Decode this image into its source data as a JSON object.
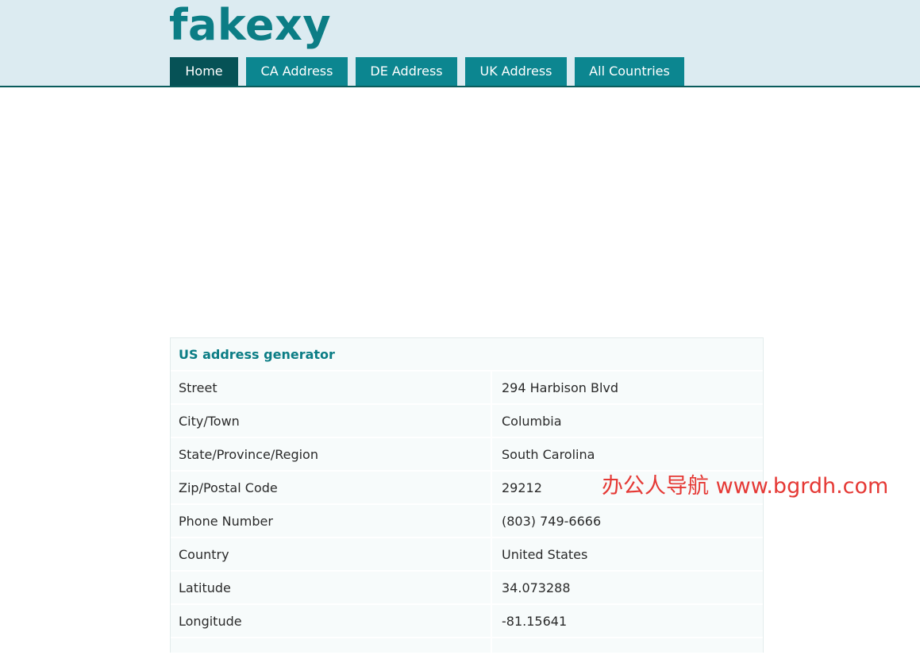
{
  "site": {
    "logo": "fakexy"
  },
  "nav": {
    "tabs": [
      {
        "label": "Home",
        "active": true
      },
      {
        "label": "CA Address",
        "active": false
      },
      {
        "label": "DE Address",
        "active": false
      },
      {
        "label": "UK Address",
        "active": false
      },
      {
        "label": "All Countries",
        "active": false
      }
    ]
  },
  "card": {
    "title": "US address generator",
    "rows": [
      {
        "label": "Street",
        "value": "294 Harbison Blvd"
      },
      {
        "label": "City/Town",
        "value": "Columbia"
      },
      {
        "label": "State/Province/Region",
        "value": "South Carolina"
      },
      {
        "label": "Zip/Postal Code",
        "value": "29212"
      },
      {
        "label": "Phone Number",
        "value": "(803) 749-6666"
      },
      {
        "label": "Country",
        "value": "United States"
      },
      {
        "label": "Latitude",
        "value": "34.073288"
      },
      {
        "label": "Longitude",
        "value": "-81.15641"
      }
    ]
  },
  "watermark": {
    "text": "办公人导航 www.bgrdh.com"
  },
  "colors": {
    "header_bg": "#dcebf1",
    "brand": "#0b7d85",
    "tab_bg": "#0c8690",
    "tab_active_bg": "#065256",
    "watermark": "#e53935"
  }
}
